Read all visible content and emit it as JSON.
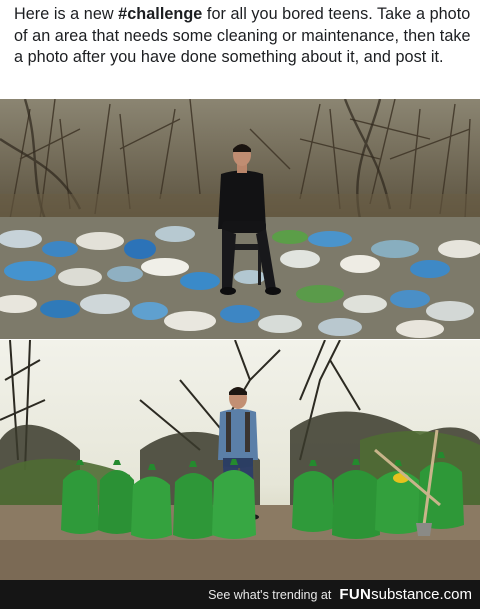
{
  "post": {
    "caption_part1": "Here is a new ",
    "caption_hashtag": "#challenge",
    "caption_part2": " for all you bored teens. Take a photo of an area that needs some cleaning or maintenance, then take a photo after you have done something about it, and post it."
  },
  "footer": {
    "trending_text": "See what's trending at",
    "logo_bold": "FUN",
    "logo_rest": "substance.com"
  },
  "colors": {
    "footer_bg": "#151515",
    "bag_green": "#2f9a3a",
    "caption_text": "#1c1e21"
  }
}
